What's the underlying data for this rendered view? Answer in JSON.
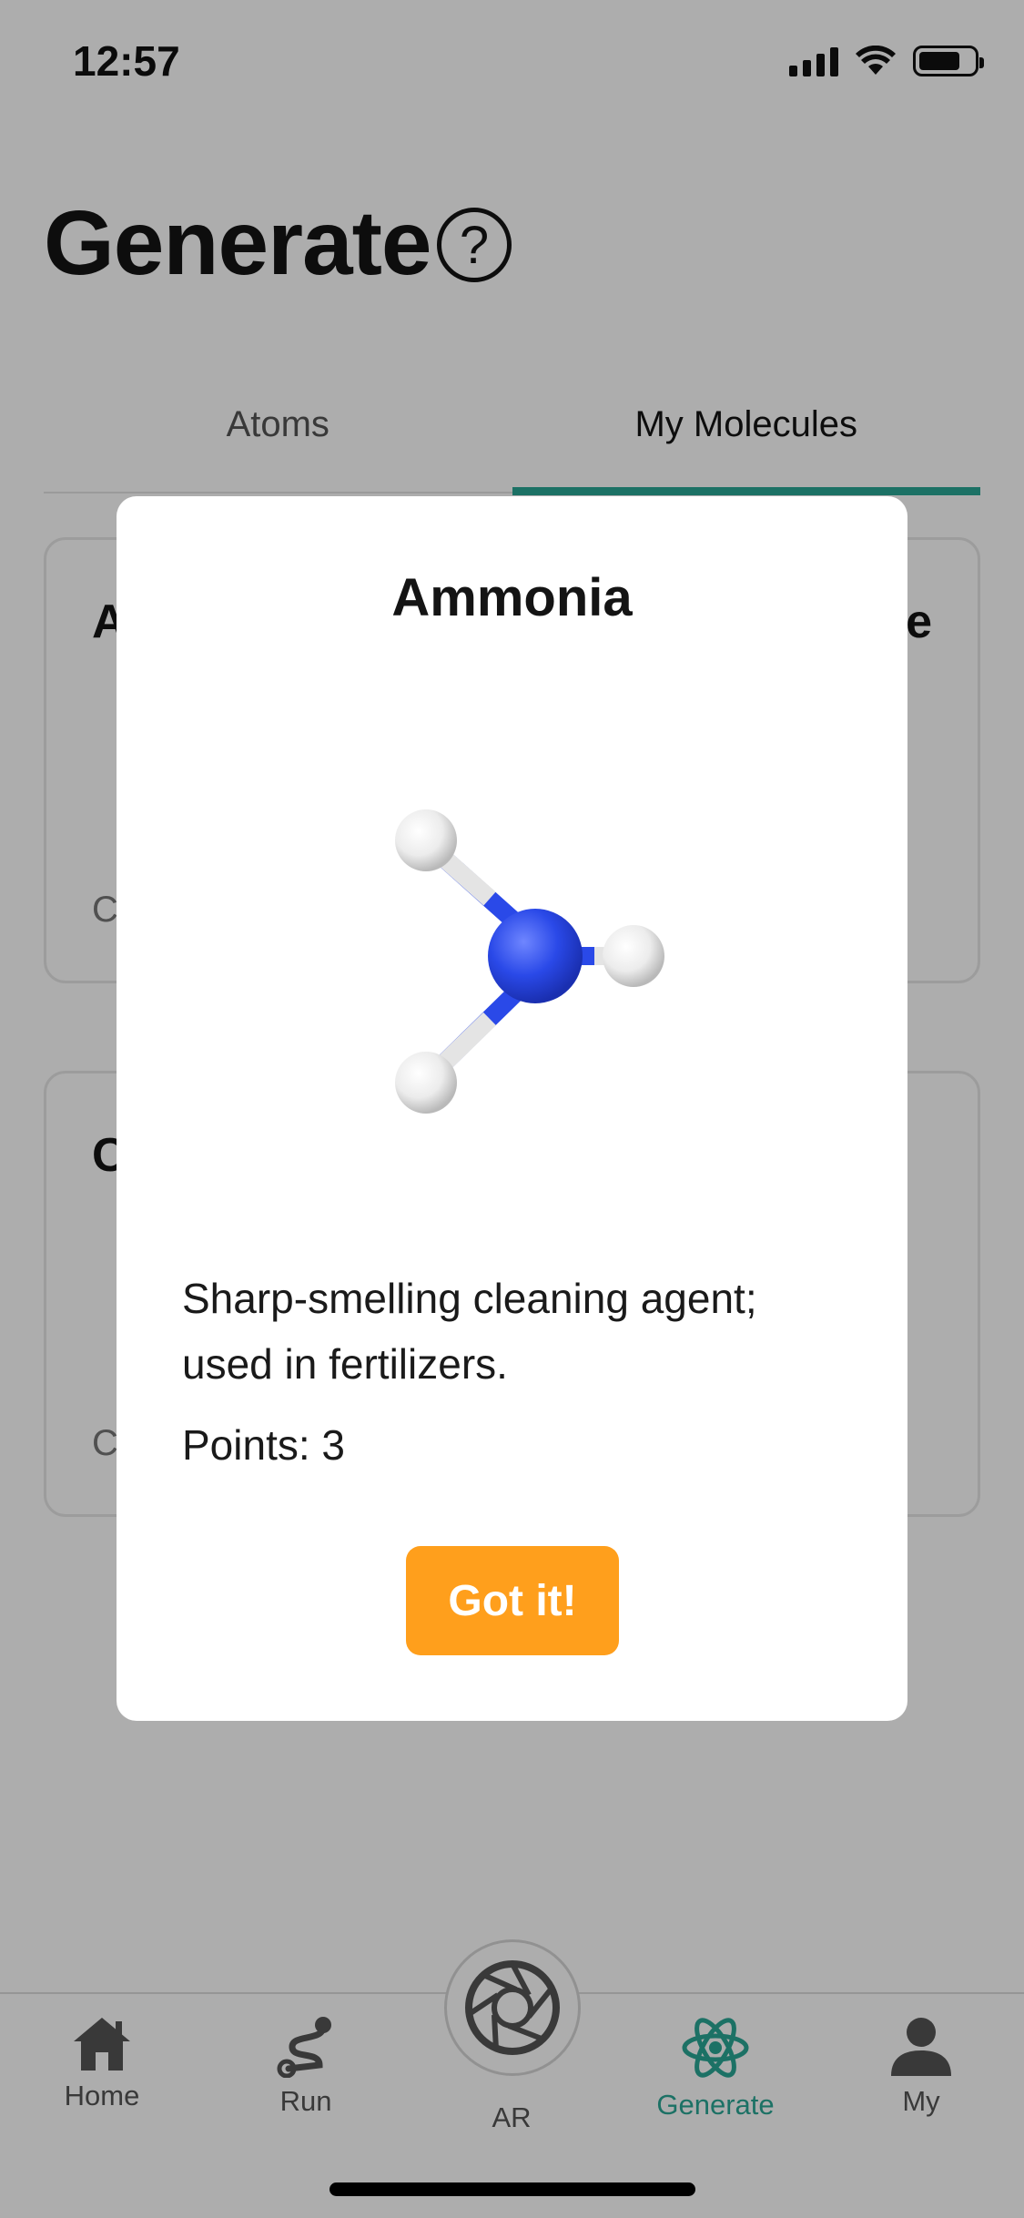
{
  "status_bar": {
    "time": "12:57"
  },
  "header": {
    "title": "Generate",
    "help_icon": "question-circle-icon"
  },
  "tabs": [
    {
      "label": "Atoms",
      "active": false
    },
    {
      "label": "My Molecules",
      "active": true
    }
  ],
  "cards": [
    {
      "title_start": "A",
      "title_end": "e",
      "sub_start": "C"
    },
    {
      "title_start": "C",
      "title_end": "",
      "sub_start": "C"
    }
  ],
  "modal": {
    "title": "Ammonia",
    "molecule_icon": "ammonia-molecule-model",
    "description": "Sharp-smelling cleaning agent; used in fertilizers.",
    "points": "Points: 3",
    "button_label": "Got it!"
  },
  "tabbar": {
    "items": [
      {
        "label": "Home",
        "icon": "house-icon"
      },
      {
        "label": "Run",
        "icon": "route-icon"
      },
      {
        "label": "AR",
        "icon": "camera-aperture-icon"
      },
      {
        "label": "Generate",
        "icon": "atom-icon",
        "active": true
      },
      {
        "label": "My",
        "icon": "person-icon"
      }
    ]
  },
  "colors": {
    "accent": "#2aa795",
    "button": "#ff9f1c",
    "nitrogen": "#2a49e8",
    "hydrogen": "#f2f2f2"
  }
}
